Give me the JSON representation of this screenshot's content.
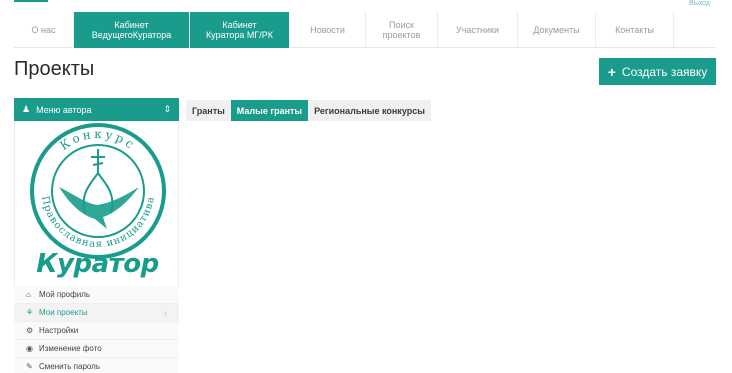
{
  "colors": {
    "accent": "#1a9c8c"
  },
  "header": {
    "corner_link": "Выход"
  },
  "nav": [
    {
      "label": "О нас",
      "active": false,
      "width": 60
    },
    {
      "label": "Кабинет\nВедущегоКуратора",
      "active": true,
      "width": 116
    },
    {
      "label": "Кабинет\nКуратора МГ/РК",
      "active": true,
      "width": 100
    },
    {
      "label": "Новости",
      "active": false,
      "width": 76
    },
    {
      "label": "Поиск\nпроектов",
      "active": false,
      "width": 72
    },
    {
      "label": "Участники",
      "active": false,
      "width": 80
    },
    {
      "label": "Документы",
      "active": false,
      "width": 78
    },
    {
      "label": "Контакты",
      "active": false,
      "width": 78
    }
  ],
  "page": {
    "title": "Проекты"
  },
  "create_button": {
    "label": "Создать заявку",
    "icon": "plus-icon"
  },
  "sidebar": {
    "menu_title": "Меню автора",
    "logo": {
      "arc_text": "Конкурс",
      "ring_text": "Православная инициатива",
      "word": "Куратор"
    },
    "items": [
      {
        "label": "Мой профиль",
        "icon": "home-icon",
        "glyph": "⌂",
        "active": false,
        "arrow": ""
      },
      {
        "label": "Мои проекты",
        "icon": "projects-icon",
        "glyph": "⚘",
        "active": true,
        "arrow": "›"
      },
      {
        "label": "Настройки",
        "icon": "gears-icon",
        "glyph": "⚙",
        "active": false,
        "arrow": ""
      },
      {
        "label": "Изменение фото",
        "icon": "eye-icon",
        "glyph": "◉",
        "active": false,
        "arrow": ""
      },
      {
        "label": "Сменить пароль",
        "icon": "edit-icon",
        "glyph": "✎",
        "active": false,
        "arrow": ""
      }
    ]
  },
  "tabs": [
    {
      "label": "Гранты",
      "active": false
    },
    {
      "label": "Малые гранты",
      "active": true
    },
    {
      "label": "Региональные конкурсы",
      "active": false
    }
  ]
}
